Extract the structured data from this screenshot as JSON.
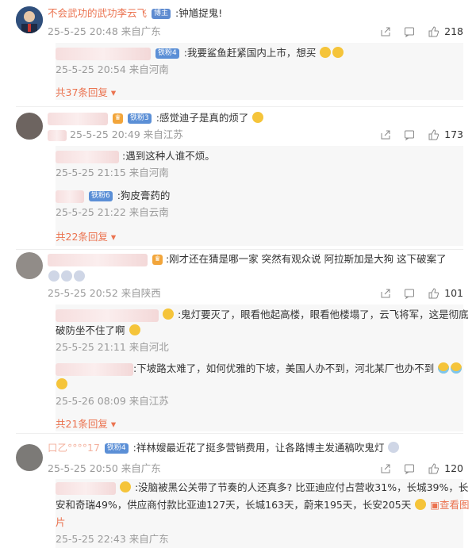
{
  "comments": [
    {
      "username": "不会武功的武功李云飞",
      "badge": "博主",
      "text": ":钟馗捉鬼!",
      "time": "25-5-25 20:48 来自广东",
      "likes": "218",
      "replies": [
        {
          "badge": "铁粉4",
          "text": ":我要鲨鱼赶紧国内上市，想买",
          "time": "25-5-25 20:54 来自河南"
        }
      ],
      "more": "共37条回复"
    },
    {
      "badge": "铁粉3",
      "text": ":感觉迪子是真的烦了",
      "time": "25-5-25 20:49 来自江苏",
      "likes": "173",
      "replies": [
        {
          "text": ":遇到这种人谁不烦。",
          "time": "25-5-25 21:15 来自河南"
        },
        {
          "badge": "铁粉6",
          "text": ":狗皮膏药的",
          "time": "25-5-25 21:22 来自云南"
        }
      ],
      "more": "共22条回复"
    },
    {
      "text": ":刚才还在猜是哪一家 突然有观众说 阿拉斯加是大狗 这下破案了",
      "time": "25-5-25 20:52 来自陕西",
      "likes": "101",
      "replies": [
        {
          "text1": ":鬼灯要灭了，眼看他起高楼，眼看他楼塌了，云飞将军，这是彻底",
          "text2": "破防坐不住了啊",
          "time": "25-5-25 21:11 来自河北"
        },
        {
          "text1": ":下坡路太难了，如何优雅的下坡，美国人办不到，河北某厂也办不到",
          "time": "25-5-26 08:09 来自江苏"
        }
      ],
      "more": "共21条回复"
    },
    {
      "username_partial": "口乙°°°°17",
      "badge": "铁粉4",
      "text": ":祥林嫂最近花了挺多营销费用，让各路博主发通稿吹鬼灯",
      "time": "25-5-25 20:50 来自广东",
      "likes": "120",
      "replies": [
        {
          "text1": ":没脑被黑公关带了节奏的人还真多? 比亚迪应付占营收31%，长城39%，长",
          "text2": "安和奇瑞49%，供应商付款比亚迪127天，长城163天，蔚来195天，长安205天",
          "link": "查看图",
          "text3": "片",
          "time": "25-5-25 22:43 来自广东"
        }
      ]
    }
  ],
  "icons": [
    "share-icon",
    "comment-icon",
    "like-icon"
  ]
}
